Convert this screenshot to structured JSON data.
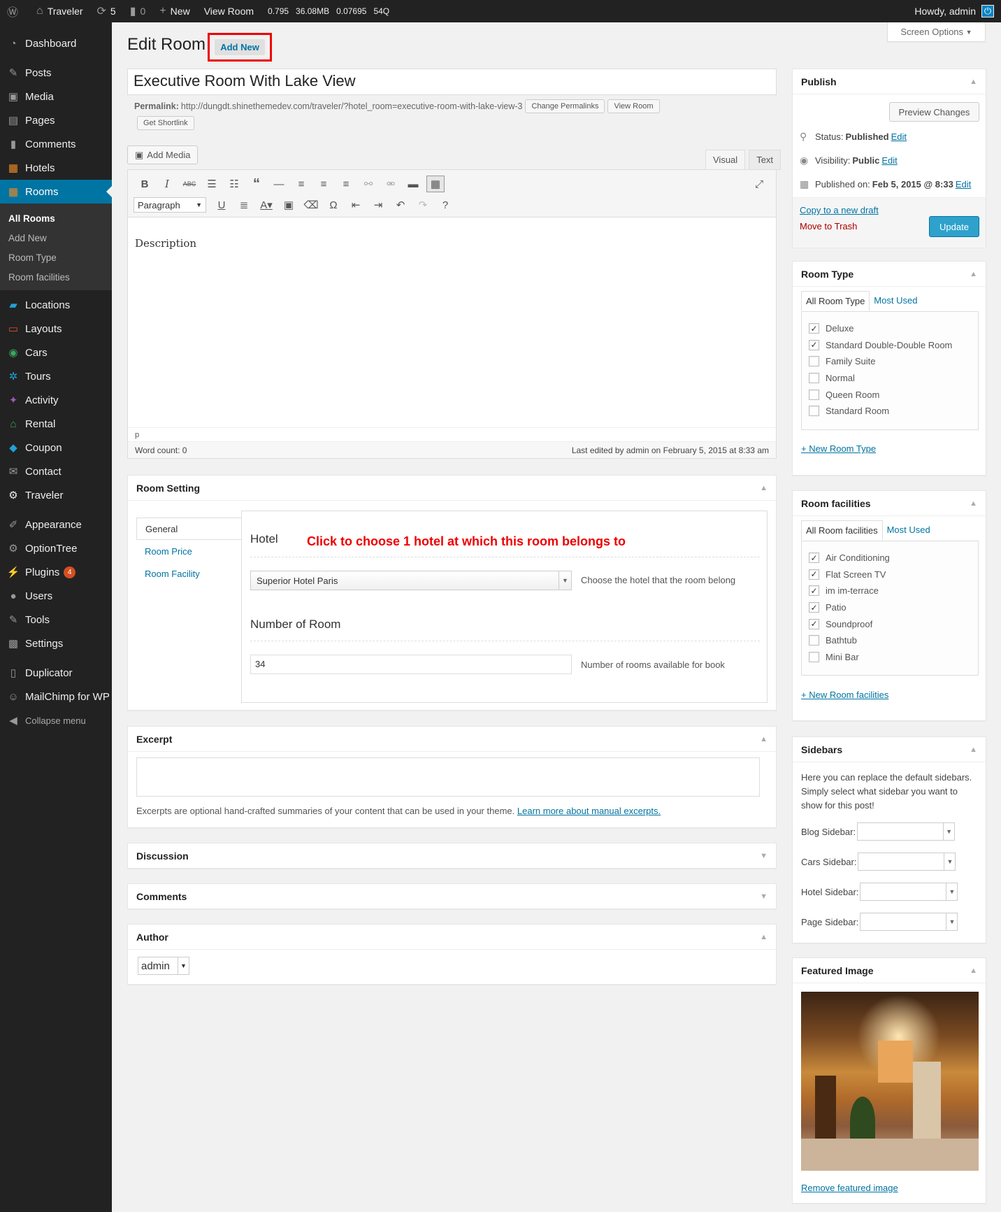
{
  "adminbar": {
    "wp_logo": "wordpress-icon",
    "site_name": "Traveler",
    "updates_count": "5",
    "comments_count": "0",
    "new_label": "New",
    "view_label": "View Room",
    "stats": "0.795   36.08MB   0.07695   54Q",
    "howdy": "Howdy, admin"
  },
  "menu": {
    "items_top": [
      {
        "label": "Dashboard",
        "icon": "dashboard-icon"
      }
    ],
    "items_main": [
      {
        "label": "Posts",
        "icon": "pin-icon"
      },
      {
        "label": "Media",
        "icon": "media-icon"
      },
      {
        "label": "Pages",
        "icon": "pages-icon"
      },
      {
        "label": "Comments",
        "icon": "comment-icon"
      },
      {
        "label": "Hotels",
        "icon": "building-icon"
      },
      {
        "label": "Rooms",
        "icon": "building-icon"
      }
    ],
    "rooms_sub": [
      "All Rooms",
      "Add New",
      "Room Type",
      "Room facilities"
    ],
    "items_more": [
      {
        "label": "Locations",
        "icon": "map-icon"
      },
      {
        "label": "Layouts",
        "icon": "monitor-icon"
      },
      {
        "label": "Cars",
        "icon": "car-icon"
      },
      {
        "label": "Tours",
        "icon": "palm-icon"
      },
      {
        "label": "Activity",
        "icon": "activity-icon"
      },
      {
        "label": "Rental",
        "icon": "home-icon"
      },
      {
        "label": "Coupon",
        "icon": "tag-icon"
      },
      {
        "label": "Contact",
        "icon": "mail-icon"
      },
      {
        "label": "Traveler",
        "icon": "gear-icon"
      }
    ],
    "items_admin": [
      {
        "label": "Appearance",
        "icon": "brush-icon"
      },
      {
        "label": "OptionTree",
        "icon": "gear-icon"
      },
      {
        "label": "Plugins",
        "icon": "plug-icon",
        "badge": "4"
      },
      {
        "label": "Users",
        "icon": "user-icon"
      },
      {
        "label": "Tools",
        "icon": "wrench-icon"
      },
      {
        "label": "Settings",
        "icon": "settings-icon"
      }
    ],
    "items_bottom": [
      {
        "label": "Duplicator",
        "icon": "duplicator-icon"
      },
      {
        "label": "MailChimp for WP",
        "icon": "mailchimp-icon"
      }
    ],
    "collapse_label": "Collapse menu"
  },
  "page": {
    "title": "Edit Room",
    "add_new": "Add New",
    "screen_options": "Screen Options"
  },
  "post": {
    "title": "Executive Room With Lake View",
    "permalink_label": "Permalink:",
    "permalink_url": "http://dungdt.shinethemedev.com/traveler/?hotel_room=executive-room-with-lake-view-3",
    "change_permalinks": "Change Permalinks",
    "view_room": "View Room",
    "get_shortlink": "Get Shortlink"
  },
  "editor": {
    "add_media": "Add Media",
    "tab_visual": "Visual",
    "tab_text": "Text",
    "format": "Paragraph",
    "content": "Description",
    "path": "p",
    "word_count": "Word count: 0",
    "last_edited": "Last edited by admin on February 5, 2015 at 8:33 am"
  },
  "room_setting": {
    "title": "Room Setting",
    "tabs": [
      "General",
      "Room Price",
      "Room Facility"
    ],
    "hotel_label": "Hotel",
    "hotel_hint": "Click to choose 1 hotel at which this room belongs to",
    "hotel_value": "Superior Hotel Paris",
    "hotel_desc": "Choose the hotel that the room belong",
    "number_label": "Number of Room",
    "number_value": "34",
    "number_desc": "Number of rooms available for book"
  },
  "excerpt": {
    "title": "Excerpt",
    "note": "Excerpts are optional hand-crafted summaries of your content that can be used in your theme.",
    "learn_more": "Learn more about manual excerpts."
  },
  "discussion": {
    "title": "Discussion"
  },
  "comments": {
    "title": "Comments"
  },
  "author": {
    "title": "Author",
    "value": "admin"
  },
  "publish": {
    "title": "Publish",
    "preview": "Preview Changes",
    "status_label": "Status:",
    "status_value": "Published",
    "visibility_label": "Visibility:",
    "visibility_value": "Public",
    "published_label": "Published on:",
    "published_value": "Feb 5, 2015 @ 8:33",
    "edit": "Edit",
    "copy_draft": "Copy to a new draft",
    "trash": "Move to Trash",
    "update": "Update"
  },
  "room_type": {
    "title": "Room Type",
    "tab_all": "All Room Type",
    "tab_used": "Most Used",
    "items": [
      {
        "label": "Deluxe",
        "checked": true
      },
      {
        "label": "Standard Double-Double Room",
        "checked": true
      },
      {
        "label": "Family Suite",
        "checked": false
      },
      {
        "label": "Normal",
        "checked": false
      },
      {
        "label": "Queen Room",
        "checked": false
      },
      {
        "label": "Standard Room",
        "checked": false
      }
    ],
    "add_new": "+ New Room Type"
  },
  "room_facilities": {
    "title": "Room facilities",
    "tab_all": "All Room facilities",
    "tab_used": "Most Used",
    "items": [
      {
        "label": "Air Conditioning",
        "checked": true
      },
      {
        "label": "Flat Screen TV",
        "checked": true
      },
      {
        "label": "im im-terrace",
        "checked": true
      },
      {
        "label": "Patio",
        "checked": true
      },
      {
        "label": "Soundproof",
        "checked": true
      },
      {
        "label": "Bathtub",
        "checked": false
      },
      {
        "label": "Mini Bar",
        "checked": false
      }
    ],
    "add_new": "+ New Room facilities"
  },
  "sidebars": {
    "title": "Sidebars",
    "text": "Here you can replace the default sidebars. Simply select what sidebar you want to show for this post!",
    "blog": "Blog Sidebar:",
    "cars": "Cars Sidebar:",
    "hotel": "Hotel Sidebar:",
    "page": "Page Sidebar:"
  },
  "featured": {
    "title": "Featured Image",
    "remove": "Remove featured image"
  }
}
